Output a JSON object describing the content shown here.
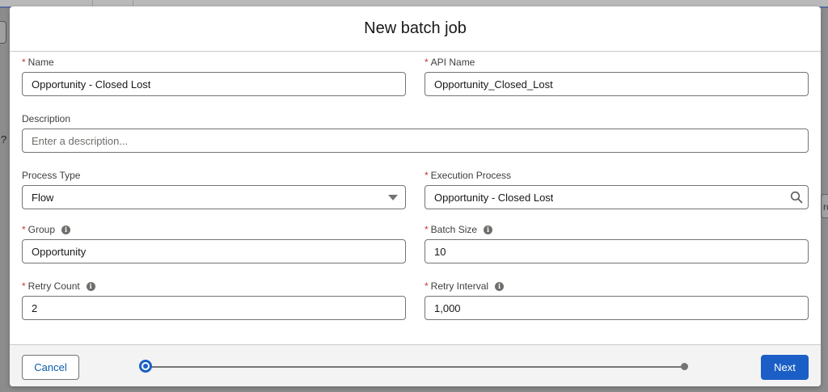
{
  "modal": {
    "title": "New batch job"
  },
  "form": {
    "name": {
      "label": "Name",
      "value": "Opportunity - Closed Lost",
      "required": true
    },
    "api_name": {
      "label": "API Name",
      "value": "Opportunity_Closed_Lost",
      "required": true
    },
    "description": {
      "label": "Description",
      "placeholder": "Enter a description..."
    },
    "process_type": {
      "label": "Process Type",
      "value": "Flow"
    },
    "execution_process": {
      "label": "Execution Process",
      "value": "Opportunity - Closed Lost",
      "required": true
    },
    "group": {
      "label": "Group",
      "value": "Opportunity",
      "required": true
    },
    "batch_size": {
      "label": "Batch Size",
      "value": "10",
      "required": true
    },
    "retry_count": {
      "label": "Retry Count",
      "value": "2",
      "required": true
    },
    "retry_interval": {
      "label": "Retry Interval",
      "value": "1,000",
      "required": true
    }
  },
  "required_marker": "*",
  "info_glyph": "i",
  "footer": {
    "cancel_label": "Cancel",
    "next_label": "Next",
    "progress": {
      "current_step": 1,
      "total_steps": 2
    }
  },
  "background": {
    "left_char": "?",
    "right_char": "rc"
  },
  "colors": {
    "brand": "#1b5fc6",
    "link": "#0b5cab",
    "required": "#c23934"
  },
  "icons": {
    "search": "search-icon",
    "dropdown": "chevron-down-icon",
    "info": "info-icon"
  }
}
